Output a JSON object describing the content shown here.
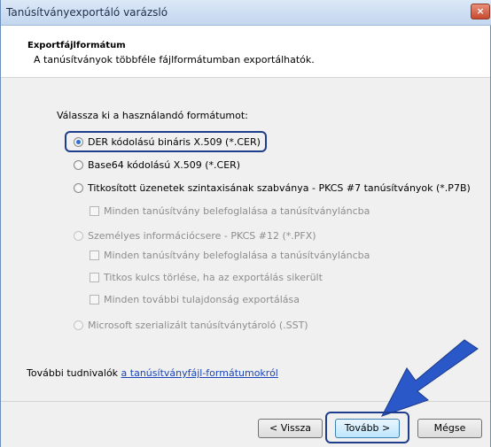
{
  "window": {
    "title": "Tanúsítványexportáló varázsló",
    "close_glyph": "×"
  },
  "header": {
    "title": "Exportfájlformátum",
    "subtitle": "A tanúsítványok többféle fájlformátumban exportálhatók."
  },
  "prompt": "Válassza ki a használandó formátumot:",
  "options": {
    "der": "DER kódolású bináris X.509 (*.CER)",
    "base64": "Base64 kódolású X.509 (*.CER)",
    "pkcs7": "Titkosított üzenetek szintaxisának szabványa - PKCS #7 tanúsítványok (*.P7B)",
    "pkcs7_include_all": "Minden tanúsítvány belefoglalása a tanúsítványláncba",
    "pfx": "Személyes információcsere - PKCS #12 (*.PFX)",
    "pfx_include_all": "Minden tanúsítvány belefoglalása a tanúsítványláncba",
    "pfx_delete_key": "Titkos kulcs törlése, ha az exportálás sikerült",
    "pfx_export_props": "Minden további tulajdonság exportálása",
    "sst": "Microsoft szerializált tanúsítványtároló (.SST)",
    "selected": "der"
  },
  "more_info": {
    "prefix": "További tudnivalók ",
    "link": "a tanúsítványfájl-formátumokról"
  },
  "buttons": {
    "back": "< Vissza",
    "next": "Tovább >",
    "cancel": "Mégse"
  },
  "colors": {
    "highlight": "#1e3d8c",
    "arrow": "#2b58c8",
    "link": "#1a44b8"
  }
}
